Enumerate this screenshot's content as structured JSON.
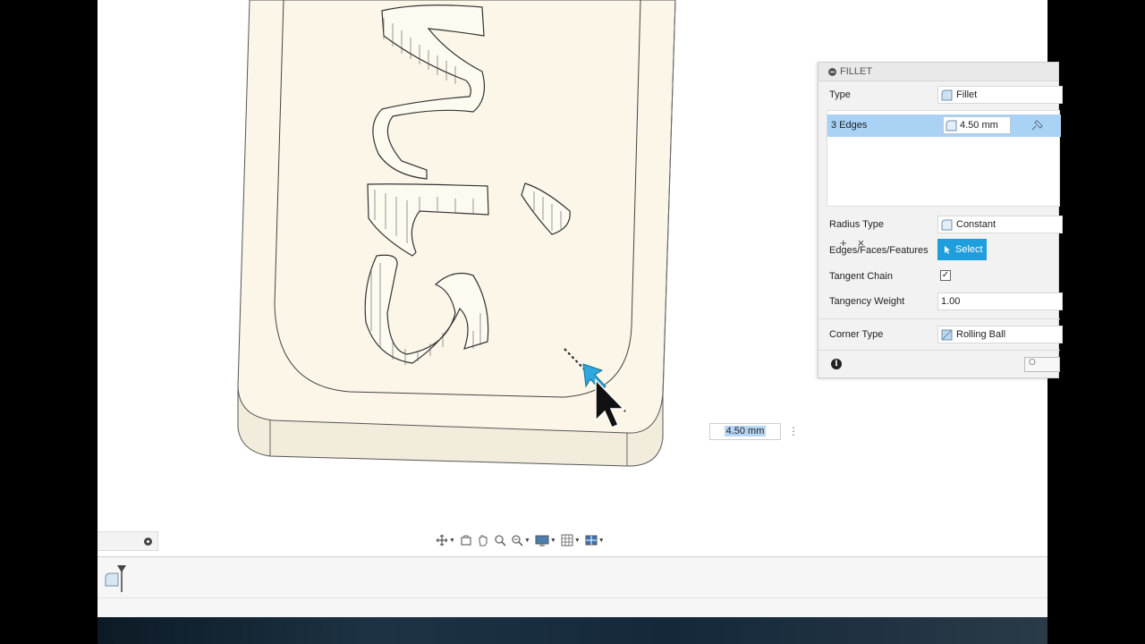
{
  "fillet_panel": {
    "title": "FILLET",
    "type_label": "Type",
    "type_value": "Fillet",
    "selection_label": "3 Edges",
    "selection_radius": "4.50 mm",
    "add_symbol": "+",
    "remove_symbol": "×",
    "radius_type_label": "Radius Type",
    "radius_type_value": "Constant",
    "edges_label": "Edges/Faces/Features",
    "select_button": "Select",
    "tangent_chain_label": "Tangent Chain",
    "tangent_chain_checked": "✓",
    "tangency_weight_label": "Tangency Weight",
    "tangency_weight_value": "1.00",
    "corner_type_label": "Corner Type",
    "corner_type_value": "Rolling Ball",
    "info_symbol": "i",
    "ok_label": "O"
  },
  "canvas_dimension": {
    "value": "4.50 mm",
    "more_symbol": "⋮"
  },
  "nav_toolbar": {
    "items": [
      "orbit-icon",
      "look-at-icon",
      "pan-icon",
      "zoom-icon",
      "fit-icon",
      "display-settings-icon",
      "grid-icon",
      "viewports-icon"
    ]
  },
  "colors": {
    "model_face": "#fbf6e8",
    "model_side": "#f1ecdb",
    "selection_blue": "#a9d2f5",
    "select_button": "#1f9ede",
    "highlight": "#b6d6f6"
  }
}
